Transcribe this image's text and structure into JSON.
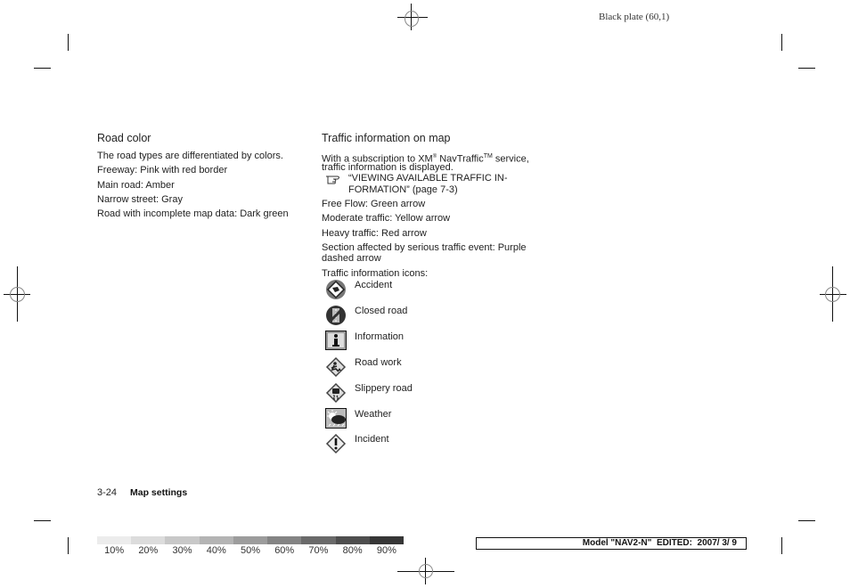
{
  "header": {
    "plate_label": "Black plate (60,1)"
  },
  "left_column": {
    "heading": "Road color",
    "paragraphs": [
      "The road types are differentiated by colors.",
      "Freeway: Pink with red border",
      "Main road: Amber",
      "Narrow street: Gray",
      "Road with incomplete map data: Dark green"
    ]
  },
  "right_column": {
    "heading": "Traffic information on map",
    "intro_line1_pre": "With a subscription to XM",
    "intro_reg": "®",
    "intro_line1_mid": " NavTraffic",
    "intro_tm": "TM",
    "intro_line1_post": " service,",
    "intro_line2": "traffic information is displayed.",
    "reference_line1": "“VIEWING AVAILABLE TRAFFIC IN-",
    "reference_line2": "FORMATION” (page 7-3)",
    "reference_icon": "pointing-hand-icon",
    "paragraphs": [
      "Free Flow: Green arrow",
      "Moderate traffic: Yellow arrow",
      "Heavy traffic: Red arrow"
    ],
    "serious_line1": "Section affected by serious traffic event: Purple",
    "serious_line2": "dashed arrow",
    "icons_heading": "Traffic information icons:",
    "icons": [
      {
        "label": "Accident",
        "icon": "accident-icon"
      },
      {
        "label": "Closed road",
        "icon": "closed-road-icon"
      },
      {
        "label": "Information",
        "icon": "information-icon"
      },
      {
        "label": "Road work",
        "icon": "road-work-icon"
      },
      {
        "label": "Slippery road",
        "icon": "slippery-road-icon"
      },
      {
        "label": "Weather",
        "icon": "weather-icon"
      },
      {
        "label": "Incident",
        "icon": "incident-icon"
      }
    ]
  },
  "footer": {
    "page_number": "3-24",
    "section_title": "Map settings",
    "grey_scale_labels": [
      "10%",
      "20%",
      "30%",
      "40%",
      "50%",
      "60%",
      "70%",
      "80%",
      "90%"
    ],
    "model_info": "Model \"NAV2-N\"  EDITED:  2007/ 3/ 9"
  }
}
